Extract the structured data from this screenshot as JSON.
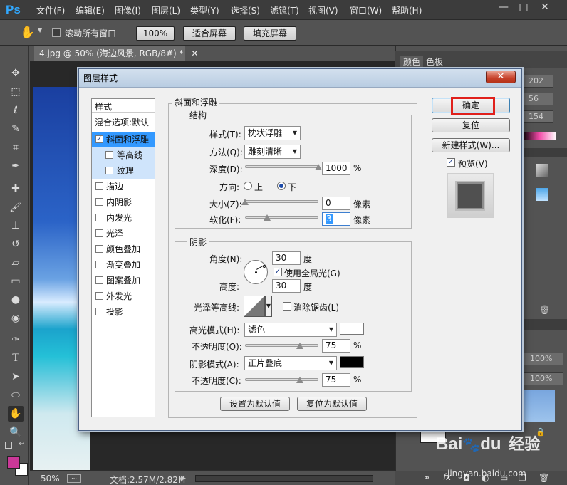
{
  "app": {
    "logo": "Ps",
    "menus": [
      "文件(F)",
      "编辑(E)",
      "图像(I)",
      "图层(L)",
      "类型(Y)",
      "选择(S)",
      "滤镜(T)",
      "视图(V)",
      "窗口(W)",
      "帮助(H)"
    ],
    "window_controls": {
      "minimize": "—",
      "restore": "□",
      "close": "✕"
    }
  },
  "options_bar": {
    "scroll_all_windows": "滚动所有窗口",
    "zoom_100": "100%",
    "fit_screen": "适合屏幕",
    "fill_screen": "填充屏幕"
  },
  "document": {
    "tab_title": "4.jpg @ 50% (海边风景, RGB/8#) *",
    "zoom": "50%",
    "doc_size": "文档:2.57M/2.82M"
  },
  "panels": {
    "tabs": [
      "颜色",
      "色板"
    ],
    "rgb_values": [
      "202",
      "56",
      "154"
    ],
    "opacity_values": [
      "100%",
      "100%"
    ]
  },
  "dialog": {
    "title": "图层样式",
    "close": "✕",
    "style_list": {
      "header": "样式",
      "blend_options": "混合选项:默认",
      "items": [
        {
          "label": "斜面和浮雕",
          "checked": true,
          "sub": false,
          "state": "selected"
        },
        {
          "label": "等高线",
          "checked": false,
          "sub": true,
          "state": "subsel"
        },
        {
          "label": "纹理",
          "checked": false,
          "sub": true,
          "state": "subsel"
        },
        {
          "label": "描边",
          "checked": false,
          "sub": false,
          "state": ""
        },
        {
          "label": "内阴影",
          "checked": false,
          "sub": false,
          "state": ""
        },
        {
          "label": "内发光",
          "checked": false,
          "sub": false,
          "state": ""
        },
        {
          "label": "光泽",
          "checked": false,
          "sub": false,
          "state": ""
        },
        {
          "label": "颜色叠加",
          "checked": false,
          "sub": false,
          "state": ""
        },
        {
          "label": "渐变叠加",
          "checked": false,
          "sub": false,
          "state": ""
        },
        {
          "label": "图案叠加",
          "checked": false,
          "sub": false,
          "state": ""
        },
        {
          "label": "外发光",
          "checked": false,
          "sub": false,
          "state": ""
        },
        {
          "label": "投影",
          "checked": false,
          "sub": false,
          "state": ""
        }
      ]
    },
    "bevel": {
      "group_title": "斜面和浮雕",
      "structure_title": "结构",
      "style_label": "样式(T):",
      "style_value": "枕状浮雕",
      "technique_label": "方法(Q):",
      "technique_value": "雕刻清晰",
      "depth_label": "深度(D):",
      "depth_value": "1000",
      "depth_unit": "%",
      "depth_level": 1.0,
      "direction_label": "方向:",
      "direction_up": "上",
      "direction_down": "下",
      "size_label": "大小(Z):",
      "size_value": "0",
      "size_unit": "像素",
      "size_level": 0.0,
      "soften_label": "软化(F):",
      "soften_value": "3",
      "soften_unit": "像素",
      "soften_level": 0.3
    },
    "shading": {
      "group_title": "阴影",
      "angle_label": "角度(N):",
      "angle_value": "30",
      "angle_unit": "度",
      "global_light": "使用全局光(G)",
      "altitude_label": "高度:",
      "altitude_value": "30",
      "altitude_unit": "度",
      "gloss_contour_label": "光泽等高线:",
      "anti_aliased": "消除锯齿(L)",
      "highlight_mode_label": "高光模式(H):",
      "highlight_mode_value": "滤色",
      "highlight_color": "#ffffff",
      "highlight_opacity_label": "不透明度(O):",
      "highlight_opacity_value": "75",
      "highlight_opacity_unit": "%",
      "highlight_opacity_level": 0.75,
      "shadow_mode_label": "阴影模式(A):",
      "shadow_mode_value": "正片叠底",
      "shadow_color": "#000000",
      "shadow_opacity_label": "不透明度(C):",
      "shadow_opacity_value": "75",
      "shadow_opacity_unit": "%",
      "shadow_opacity_level": 0.75
    },
    "buttons": {
      "make_default": "设置为默认值",
      "reset_default": "复位为默认值",
      "ok": "确定",
      "reset": "复位",
      "new_style": "新建样式(W)...",
      "preview": "预览(V)"
    },
    "highlight_box_color": "#e0201b"
  },
  "watermark": {
    "brand": "Bai",
    "brand2": "du",
    "cn": "经验",
    "url": "jingyan.baidu.com"
  }
}
